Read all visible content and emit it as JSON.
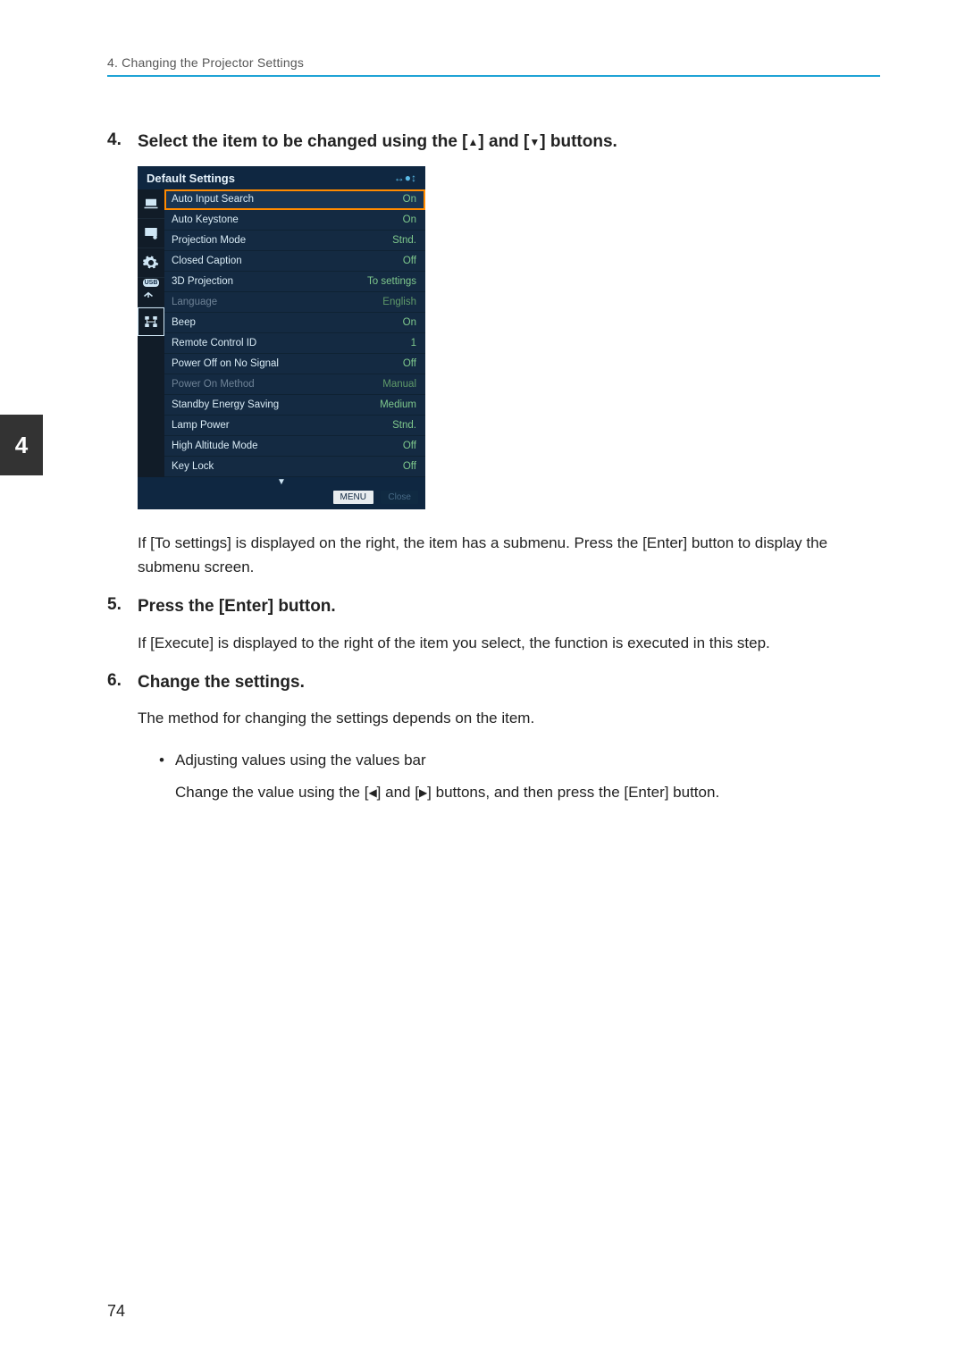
{
  "runningHead": "4. Changing the Projector Settings",
  "chapterTab": "4",
  "pageNumber": "74",
  "step4": {
    "num": "4.",
    "title_pre": "Select the item to be changed using the [",
    "title_mid": "] and [",
    "title_post": "] buttons."
  },
  "step4_desc": "If [To settings] is displayed on the right, the item has a submenu. Press the [Enter] button to display the submenu screen.",
  "step5": {
    "num": "5.",
    "title": "Press the [Enter] button."
  },
  "step5_desc": "If [Execute] is displayed to the right of the item you select, the function is executed in this step.",
  "step6": {
    "num": "6.",
    "title": "Change the settings."
  },
  "step6_desc": "The method for changing the settings depends on the item.",
  "step6_bullet": "Adjusting values using the values bar",
  "step6_sub_pre": "Change the value using the [",
  "step6_sub_mid": "] and [",
  "step6_sub_post": "] buttons, and then press the [Enter] button.",
  "osd": {
    "title": "Default Settings",
    "rows": [
      {
        "label": "Auto Input Search",
        "val": "On",
        "sel": true
      },
      {
        "label": "Auto Keystone",
        "val": "On"
      },
      {
        "label": "Projection Mode",
        "val": "Stnd."
      },
      {
        "label": "Closed Caption",
        "val": "Off"
      },
      {
        "label": "3D Projection",
        "val": "To settings"
      },
      {
        "label": "Language",
        "val": "English",
        "dim": true
      },
      {
        "label": "Beep",
        "val": "On"
      },
      {
        "label": "Remote Control ID",
        "val": "1"
      },
      {
        "label": "Power Off on No Signal",
        "val": "Off"
      },
      {
        "label": "Power On Method",
        "val": "Manual",
        "dim": true
      },
      {
        "label": "Standby Energy Saving",
        "val": "Medium"
      },
      {
        "label": "Lamp Power",
        "val": "Stnd."
      },
      {
        "label": "High Altitude Mode",
        "val": "Off"
      },
      {
        "label": "Key Lock",
        "val": "Off"
      }
    ],
    "footMenu": "MENU",
    "footClose": "Close"
  }
}
